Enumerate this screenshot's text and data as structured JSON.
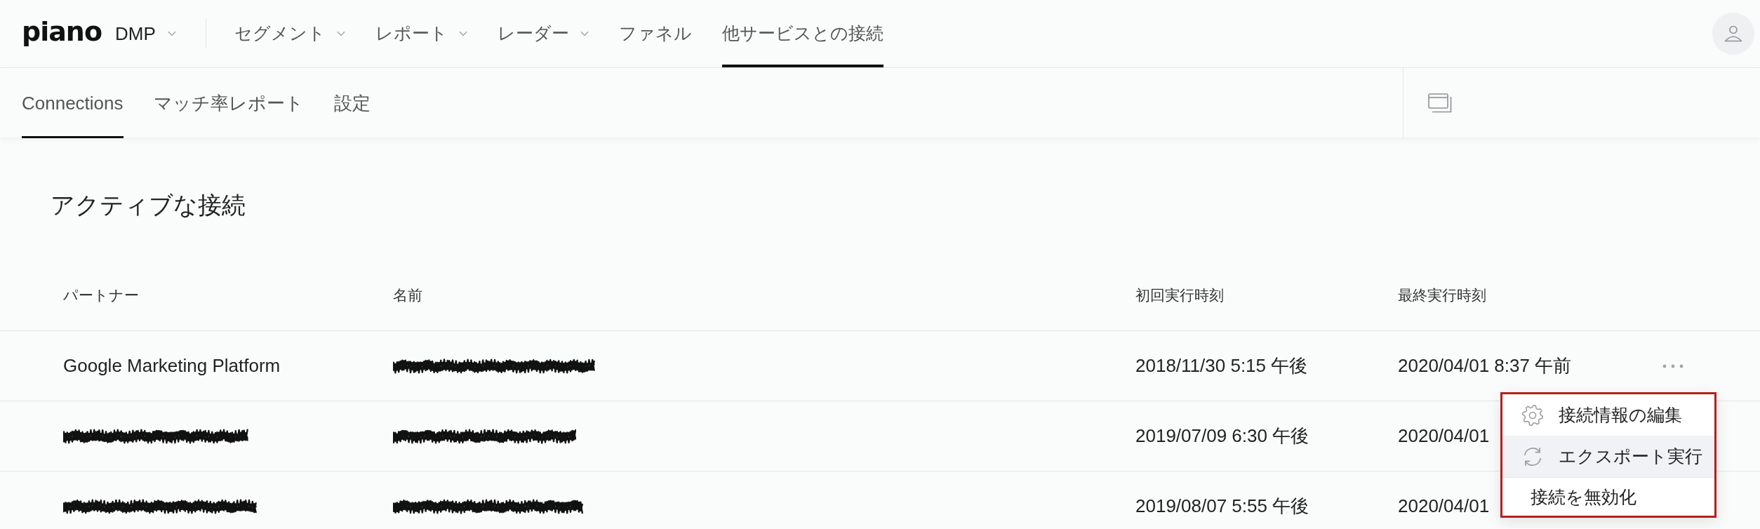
{
  "top_nav": {
    "logo": "piano",
    "product": "DMP",
    "product_dropdown": true,
    "items": [
      {
        "label": "セグメント",
        "dropdown": true,
        "selected": false
      },
      {
        "label": "レポート",
        "dropdown": true,
        "selected": false
      },
      {
        "label": "レーダー",
        "dropdown": true,
        "selected": false
      },
      {
        "label": "ファネル",
        "dropdown": false,
        "selected": false
      },
      {
        "label": "他サービスとの接続",
        "dropdown": false,
        "selected": true
      }
    ]
  },
  "sub_nav": {
    "tabs": [
      {
        "label": "Connections",
        "selected": true
      },
      {
        "label": "マッチ率レポート",
        "selected": false
      },
      {
        "label": "設定",
        "selected": false
      }
    ]
  },
  "section": {
    "title": "アクティブな接続"
  },
  "table": {
    "columns": [
      "パートナー",
      "名前",
      "初回実行時刻",
      "最終実行時刻"
    ],
    "rows": [
      {
        "cells": [
          {
            "kind": "text",
            "text": "Google Marketing Platform"
          },
          {
            "kind": "redacted"
          },
          {
            "kind": "text",
            "text": "2018/11/30 5:15 午後"
          },
          {
            "kind": "text",
            "text": "2020/04/01 8:37 午前"
          }
        ],
        "menu": {
          "highlight": true,
          "items": [
            {
              "label": "接続情報の編集",
              "selected": false,
              "separated": false
            },
            {
              "label": "エクスポート実行",
              "selected": true,
              "separated": false
            },
            {
              "label": "接続を無効化",
              "selected": false,
              "separated": true
            }
          ]
        }
      },
      {
        "cells": [
          {
            "kind": "redacted"
          },
          {
            "kind": "redacted"
          },
          {
            "kind": "text",
            "text": "2019/07/09 6:30 午後"
          },
          {
            "kind": "text",
            "text": "2020/04/01"
          }
        ]
      },
      {
        "cells": [
          {
            "kind": "redacted"
          },
          {
            "kind": "redacted"
          },
          {
            "kind": "text",
            "text": "2019/08/07 5:55 午後"
          },
          {
            "kind": "text",
            "text": "2020/04/01"
          }
        ]
      }
    ]
  }
}
